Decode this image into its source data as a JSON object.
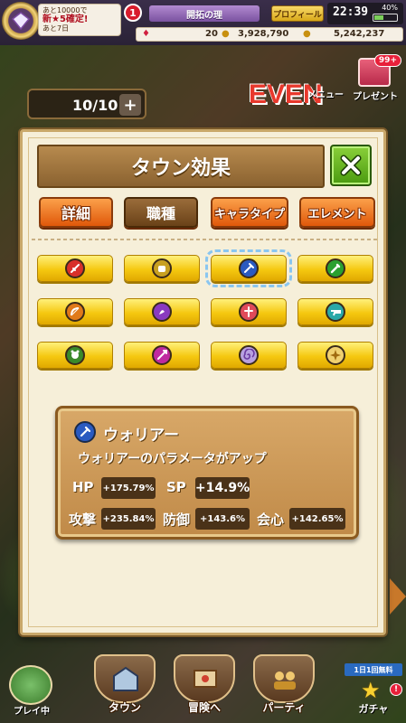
{
  "colors": {
    "panel_bg": "#f6efd9",
    "tab_orange": "#f07a20",
    "tab_active": "#7a5028",
    "job_yellow": "#f5c810",
    "close_green": "#5aaa1a",
    "card_bg": "#c99a5a"
  },
  "status_bar": {
    "gacha_note_line1": "あと",
    "gacha_note_count": "10000",
    "gacha_note_line1_suffix": "で",
    "gacha_note_line2": "新★5確定!",
    "gacha_note_line3": "あと7日",
    "notification_count": "1",
    "title_banner": "開拓の理",
    "profile_label": "プロフィール",
    "time": "22:39",
    "battery": "40%",
    "battery_level": 0.4,
    "gems": "20",
    "gold": "3,928,790",
    "points": "5,242,237"
  },
  "hud": {
    "stamina": "10/10",
    "stamina_plus": "+",
    "event_label": "EVEN",
    "menu_label": "メニュー",
    "present_label": "プレゼント",
    "present_count": "99+"
  },
  "panel": {
    "title": "タウン効果",
    "tabs": [
      {
        "label": "詳細",
        "active": false
      },
      {
        "label": "職種",
        "active": true
      },
      {
        "label": "キャラタイプ",
        "active": false
      },
      {
        "label": "エレメント",
        "active": false
      }
    ],
    "jobs": [
      {
        "icon": "sword-icon",
        "color": "#d8302a",
        "selected": false
      },
      {
        "icon": "fist-icon",
        "color": "#c8a020",
        "selected": false
      },
      {
        "icon": "axe-icon",
        "color": "#2a5ac0",
        "selected": true
      },
      {
        "icon": "dagger-icon",
        "color": "#2aa030",
        "selected": false
      },
      {
        "icon": "bow-icon",
        "color": "#e07a1a",
        "selected": false
      },
      {
        "icon": "magic-icon",
        "color": "#8a3ac0",
        "selected": false
      },
      {
        "icon": "cross-staff-icon",
        "color": "#e04a5a",
        "selected": false
      },
      {
        "icon": "gun-icon",
        "color": "#2aa8a8",
        "selected": false
      },
      {
        "icon": "beast-icon",
        "color": "#3a8a2a",
        "selected": false
      },
      {
        "icon": "spear-icon",
        "color": "#c02aa0",
        "selected": false
      },
      {
        "icon": "spiral-icon",
        "color": "#b8a0e0",
        "selected": false
      },
      {
        "icon": "star-burst-icon",
        "color": "#f0d070",
        "selected": false
      }
    ]
  },
  "detail": {
    "title": "ウォリアー",
    "description": "ウォリアーのパラメータがアップ",
    "stats": {
      "hp_label": "HP",
      "hp_value": "+175.79%",
      "sp_label": "SP",
      "sp_value": "+14.9%",
      "atk_label": "攻撃",
      "atk_value": "+235.84%",
      "def_label": "防御",
      "def_value": "+143.6%",
      "crit_label": "会心",
      "crit_value": "+142.65%"
    }
  },
  "bottom_nav": {
    "playing_label": "プレイ中",
    "town_label": "タウン",
    "adventure_label": "冒険へ",
    "party_label": "パーティ",
    "gacha_tag": "1日1回無料",
    "gacha_label": "ガチャ",
    "gacha_alert": "!"
  }
}
